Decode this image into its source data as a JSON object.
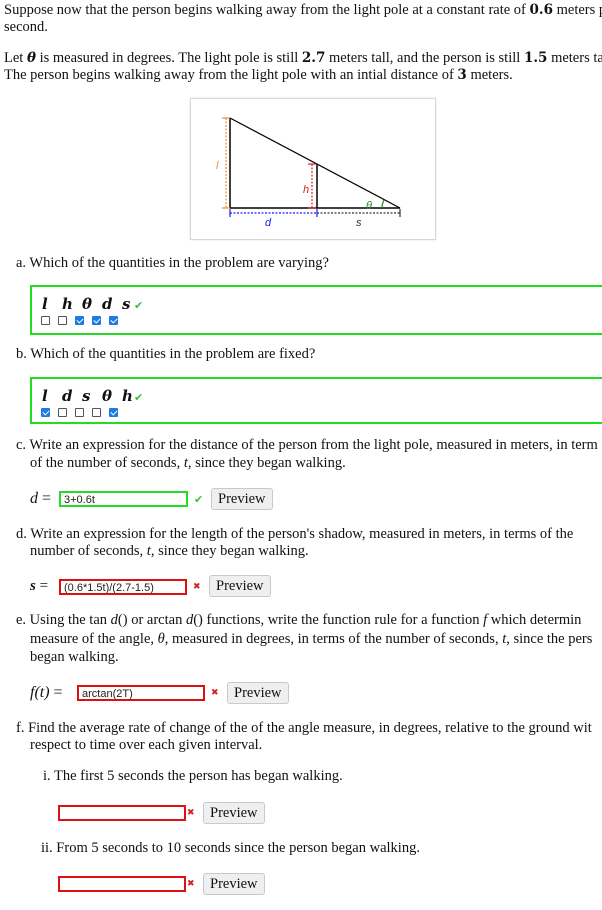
{
  "intro": {
    "line1": "Suppose now that the person begins walking away from the light pole at a constant rate of ",
    "rate": "0.6",
    "line1_end": " meters p",
    "line2": "second.",
    "line3_a": "Let ",
    "theta": "θ",
    "line3_b": " is measured in degrees. The light pole is still ",
    "pole_height": "2.7",
    "line3_c": " meters tall, and the person is still ",
    "person_height": "1.5",
    "line3_d": " meters tal",
    "line4_a": "The person begins walking away from the light pole with an intial distance of ",
    "initial_distance": "3",
    "line4_b": " meters."
  },
  "figure": {
    "label_l": "l",
    "label_h": "h",
    "label_theta": "θ",
    "label_d": "d",
    "label_s": "s",
    "colors": {
      "l": "#f08a30",
      "h": "#e02020",
      "d": "#1a1aff",
      "s": "#333333",
      "theta": "#2a8a2a"
    }
  },
  "part_a": {
    "question": "a. Which of the quantities in the problem are varying?",
    "options": [
      {
        "label": "l",
        "checked": false
      },
      {
        "label": "h",
        "checked": false
      },
      {
        "label": "θ",
        "checked": true
      },
      {
        "label": "d",
        "checked": true
      },
      {
        "label": "s",
        "checked": true
      }
    ],
    "status": "correct",
    "status_icon": "✔"
  },
  "part_b": {
    "question": "b. Which of the quantities in the problem are fixed?",
    "options": [
      {
        "label": "l",
        "checked": true
      },
      {
        "label": "d",
        "checked": false
      },
      {
        "label": "s",
        "checked": false
      },
      {
        "label": "θ",
        "checked": false
      },
      {
        "label": "h",
        "checked": true
      }
    ],
    "status": "correct",
    "status_icon": "✔"
  },
  "part_c": {
    "question_l1": "c. Write an expression for the distance of the person from the light pole, measured in meters, in term",
    "question_l2a": "of the number of seconds, ",
    "t": "t",
    "question_l2b": ", since they began walking.",
    "var": "d",
    "eq": "=",
    "value": "3+0.6t",
    "status": "correct",
    "status_icon": "✔",
    "preview": "Preview"
  },
  "part_d": {
    "question_l1": "d. Write an expression for the length of the person's shadow, measured in meters, in terms of the",
    "question_l2a": "number of seconds, ",
    "t": "t",
    "question_l2b": ", since they began walking.",
    "var": "s",
    "eq": "=",
    "value": "(0.6*1.5t)/(2.7-1.5)",
    "status": "incorrect",
    "status_icon": "✖",
    "preview": "Preview"
  },
  "part_e": {
    "question_l1a": "e. Using the ",
    "tan": "tan",
    "d1": "d",
    "paren1": "()",
    "or": " or ",
    "arctan": "arctan",
    "d2": "d",
    "paren2": "()",
    "question_l1b": " functions, write the function rule for a function ",
    "f": "f",
    "question_l1c": " which determin",
    "question_l2a": "measure of the angle, ",
    "theta": "θ",
    "question_l2b": ", measured in degrees, in terms of the number of seconds, ",
    "t": "t",
    "question_l2c": ", since the pers",
    "question_l3": "began walking.",
    "lhs": "f(t)",
    "eq": "=",
    "value": "arctan(2T)",
    "status": "incorrect",
    "status_icon": "✖",
    "preview": "Preview"
  },
  "part_f": {
    "question_l1": "f. Find the average rate of change of the of the angle measure, in degrees, relative to the ground wit",
    "question_l2": "respect to time over each given interval.",
    "sub_i": {
      "question": "i. The first 5 seconds the person has began walking.",
      "value": "",
      "status": "incorrect",
      "status_icon": "✖",
      "preview": "Preview"
    },
    "sub_ii": {
      "question": "ii. From 5 seconds to 10 seconds since the person began walking.",
      "value": "",
      "status": "incorrect",
      "status_icon": "✖",
      "preview": "Preview"
    }
  }
}
